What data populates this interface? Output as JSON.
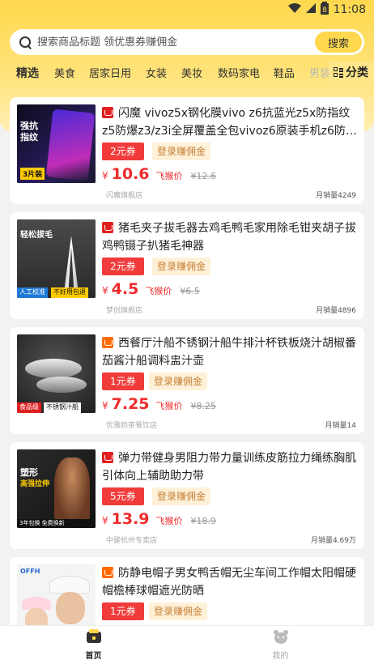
{
  "status_bar": {
    "time": "11:08",
    "battery_glyph": "8"
  },
  "search": {
    "placeholder": "搜索商品标题 领优惠券赚佣金",
    "button_label": "搜索"
  },
  "tabs": [
    {
      "label": "精选",
      "active": true
    },
    {
      "label": "美食"
    },
    {
      "label": "居家日用"
    },
    {
      "label": "女装"
    },
    {
      "label": "美妆"
    },
    {
      "label": "数码家电"
    },
    {
      "label": "鞋品"
    },
    {
      "label": "男装"
    }
  ],
  "category_button": "分类",
  "login_label": "登录赚佣金",
  "price_tag": "飞猴价",
  "currency": "¥",
  "products": [
    {
      "store_type": "tmall",
      "title": "闪魔 vivoz5x钢化膜vivo z6抗蓝光z5x防指纹z5防爆z3/z3i全屏覆盖全包vivoz6原装手机z6防摔vivo...",
      "coupon": "2元券",
      "price": "10.6",
      "original_price": "¥12.6",
      "shop": "闪魔旗舰店",
      "sales": "月销量4249",
      "thumb_text": [
        "强抗",
        "指纹",
        "3片装"
      ]
    },
    {
      "store_type": "tmall",
      "title": "猪毛夹子拔毛器去鸡毛鸭毛家用除毛钳夹胡子拔鸡鸭镊子扒猪毛神器",
      "coupon": "2元券",
      "price": "4.5",
      "original_price": "¥6.5",
      "shop": "梦创旗舰店",
      "sales": "月销量4896",
      "thumb_text": [
        "轻松拔毛",
        "人工校准",
        "不好用包退"
      ]
    },
    {
      "store_type": "taobao",
      "title": "西餐厅汁船不锈钢汁船牛排汁杯铁板烧汁胡椒番茄酱汁船调料盅汁壶",
      "coupon": "1元券",
      "price": "7.25",
      "original_price": "¥8.25",
      "shop": "优雅奶茶餐饮店",
      "sales": "月销量14",
      "thumb_text": [
        "食品级",
        "不锈钢汁船"
      ]
    },
    {
      "store_type": "tmall",
      "title": "弹力带健身男阻力带力量训练皮筋拉力绳练胸肌引体向上辅助助力带",
      "coupon": "5元券",
      "price": "13.9",
      "original_price": "¥18.9",
      "shop": "中骏杭州专卖店",
      "sales": "月销量4.69万",
      "thumb_text": [
        "塑形",
        "高强拉伸",
        "3年包换 免费换新"
      ]
    },
    {
      "store_type": "taobao",
      "title": "防静电帽子男女鸭舌帽无尘车间工作帽太阳帽硬帽檐棒球帽遮光防晒",
      "coupon": "1元券",
      "price": "",
      "original_price": "",
      "shop": "",
      "sales": "",
      "thumb_text": [
        "OFFH"
      ]
    }
  ],
  "bottom_nav": [
    {
      "label": "首页",
      "icon": "home-icon",
      "active": true
    },
    {
      "label": "我的",
      "icon": "profile-icon",
      "active": false
    }
  ],
  "colors": {
    "brand_yellow": "#ffd84d",
    "coupon_red": "#f13b3b",
    "price_red": "#ef2c2c",
    "login_bg": "#fff1d8"
  }
}
